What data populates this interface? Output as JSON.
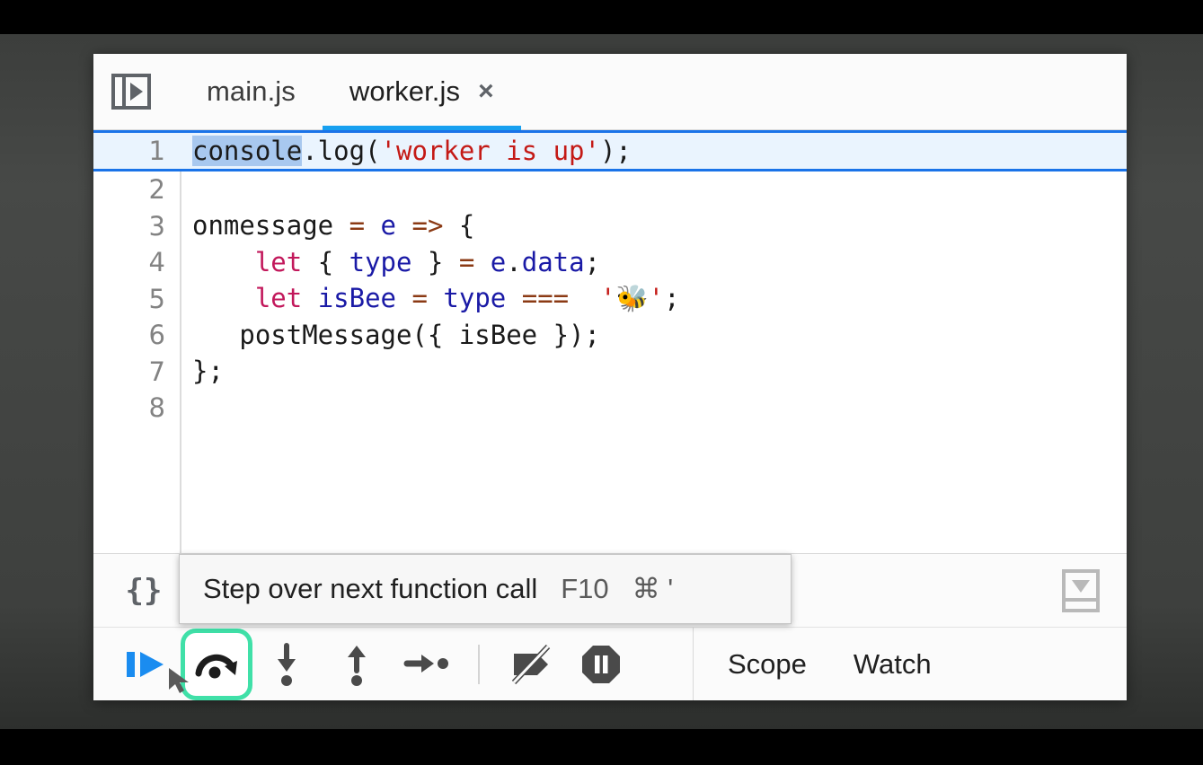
{
  "window": {
    "accent_color": "#17a0f0",
    "focus_highlight_color": "#40e0a8",
    "background_color": "#474947"
  },
  "tabstrip": {
    "panel_toggle_icon": "show-navigator-icon",
    "tabs": [
      {
        "label": "main.js",
        "active": false,
        "closable": false
      },
      {
        "label": "worker.js",
        "active": true,
        "closable": true,
        "close_label": "×"
      }
    ]
  },
  "editor": {
    "language": "javascript",
    "current_line": 1,
    "selection_text": "console",
    "lines": [
      {
        "number": "1",
        "current": true,
        "tokens": [
          {
            "t": "console",
            "c": "plain",
            "sel": true
          },
          {
            "t": ".log(",
            "c": "plain"
          },
          {
            "t": "'worker is up'",
            "c": "str"
          },
          {
            "t": ");",
            "c": "plain"
          }
        ]
      },
      {
        "number": "2",
        "current": false,
        "tokens": []
      },
      {
        "number": "3",
        "current": false,
        "tokens": [
          {
            "t": "onmessage ",
            "c": "plain"
          },
          {
            "t": "=",
            "c": "op"
          },
          {
            "t": " ",
            "c": "plain"
          },
          {
            "t": "e",
            "c": "var"
          },
          {
            "t": " ",
            "c": "plain"
          },
          {
            "t": "=>",
            "c": "op"
          },
          {
            "t": " {",
            "c": "plain"
          }
        ]
      },
      {
        "number": "4",
        "current": false,
        "tokens": [
          {
            "t": "    ",
            "c": "plain"
          },
          {
            "t": "let",
            "c": "kw"
          },
          {
            "t": " { ",
            "c": "plain"
          },
          {
            "t": "type",
            "c": "var"
          },
          {
            "t": " } ",
            "c": "plain"
          },
          {
            "t": "=",
            "c": "op"
          },
          {
            "t": " ",
            "c": "plain"
          },
          {
            "t": "e",
            "c": "var"
          },
          {
            "t": ".",
            "c": "plain"
          },
          {
            "t": "data",
            "c": "var"
          },
          {
            "t": ";",
            "c": "plain"
          }
        ]
      },
      {
        "number": "5",
        "current": false,
        "tokens": [
          {
            "t": "    ",
            "c": "plain"
          },
          {
            "t": "let",
            "c": "kw"
          },
          {
            "t": " ",
            "c": "plain"
          },
          {
            "t": "isBee",
            "c": "var"
          },
          {
            "t": " ",
            "c": "plain"
          },
          {
            "t": "=",
            "c": "op"
          },
          {
            "t": " ",
            "c": "plain"
          },
          {
            "t": "type",
            "c": "var"
          },
          {
            "t": " ",
            "c": "plain"
          },
          {
            "t": "===",
            "c": "op"
          },
          {
            "t": "  ",
            "c": "plain"
          },
          {
            "t": "'🐝'",
            "c": "str"
          },
          {
            "t": ";",
            "c": "plain"
          }
        ]
      },
      {
        "number": "6",
        "current": false,
        "tokens": [
          {
            "t": "   postMessage({ isBee });",
            "c": "plain"
          }
        ]
      },
      {
        "number": "7",
        "current": false,
        "tokens": [
          {
            "t": "};",
            "c": "plain"
          }
        ]
      },
      {
        "number": "8",
        "current": false,
        "tokens": []
      }
    ]
  },
  "statusbar": {
    "format_label": "{}",
    "format_icon": "pretty-print-braces-icon",
    "drawer_icon": "show-drawer-icon"
  },
  "tooltip": {
    "text": "Step over next function call",
    "key": "F10",
    "cmd": "⌘ '"
  },
  "debugbar": {
    "buttons": [
      {
        "name": "resume-script-execution",
        "icon": "resume-icon",
        "focused": false
      },
      {
        "name": "step-over-next-function-call",
        "icon": "step-over-icon",
        "focused": true
      },
      {
        "name": "step-into-next-function-call",
        "icon": "step-into-icon",
        "focused": false
      },
      {
        "name": "step-out-of-current-function",
        "icon": "step-out-icon",
        "focused": false
      },
      {
        "name": "step",
        "icon": "step-icon",
        "focused": false
      },
      {
        "name": "deactivate-breakpoints",
        "icon": "deactivate-breakpoints-icon",
        "focused": false
      },
      {
        "name": "pause-on-exceptions",
        "icon": "pause-on-exceptions-icon",
        "focused": false
      }
    ],
    "side_tabs": [
      {
        "label": "Scope",
        "active": true
      },
      {
        "label": "Watch",
        "active": false
      }
    ]
  }
}
